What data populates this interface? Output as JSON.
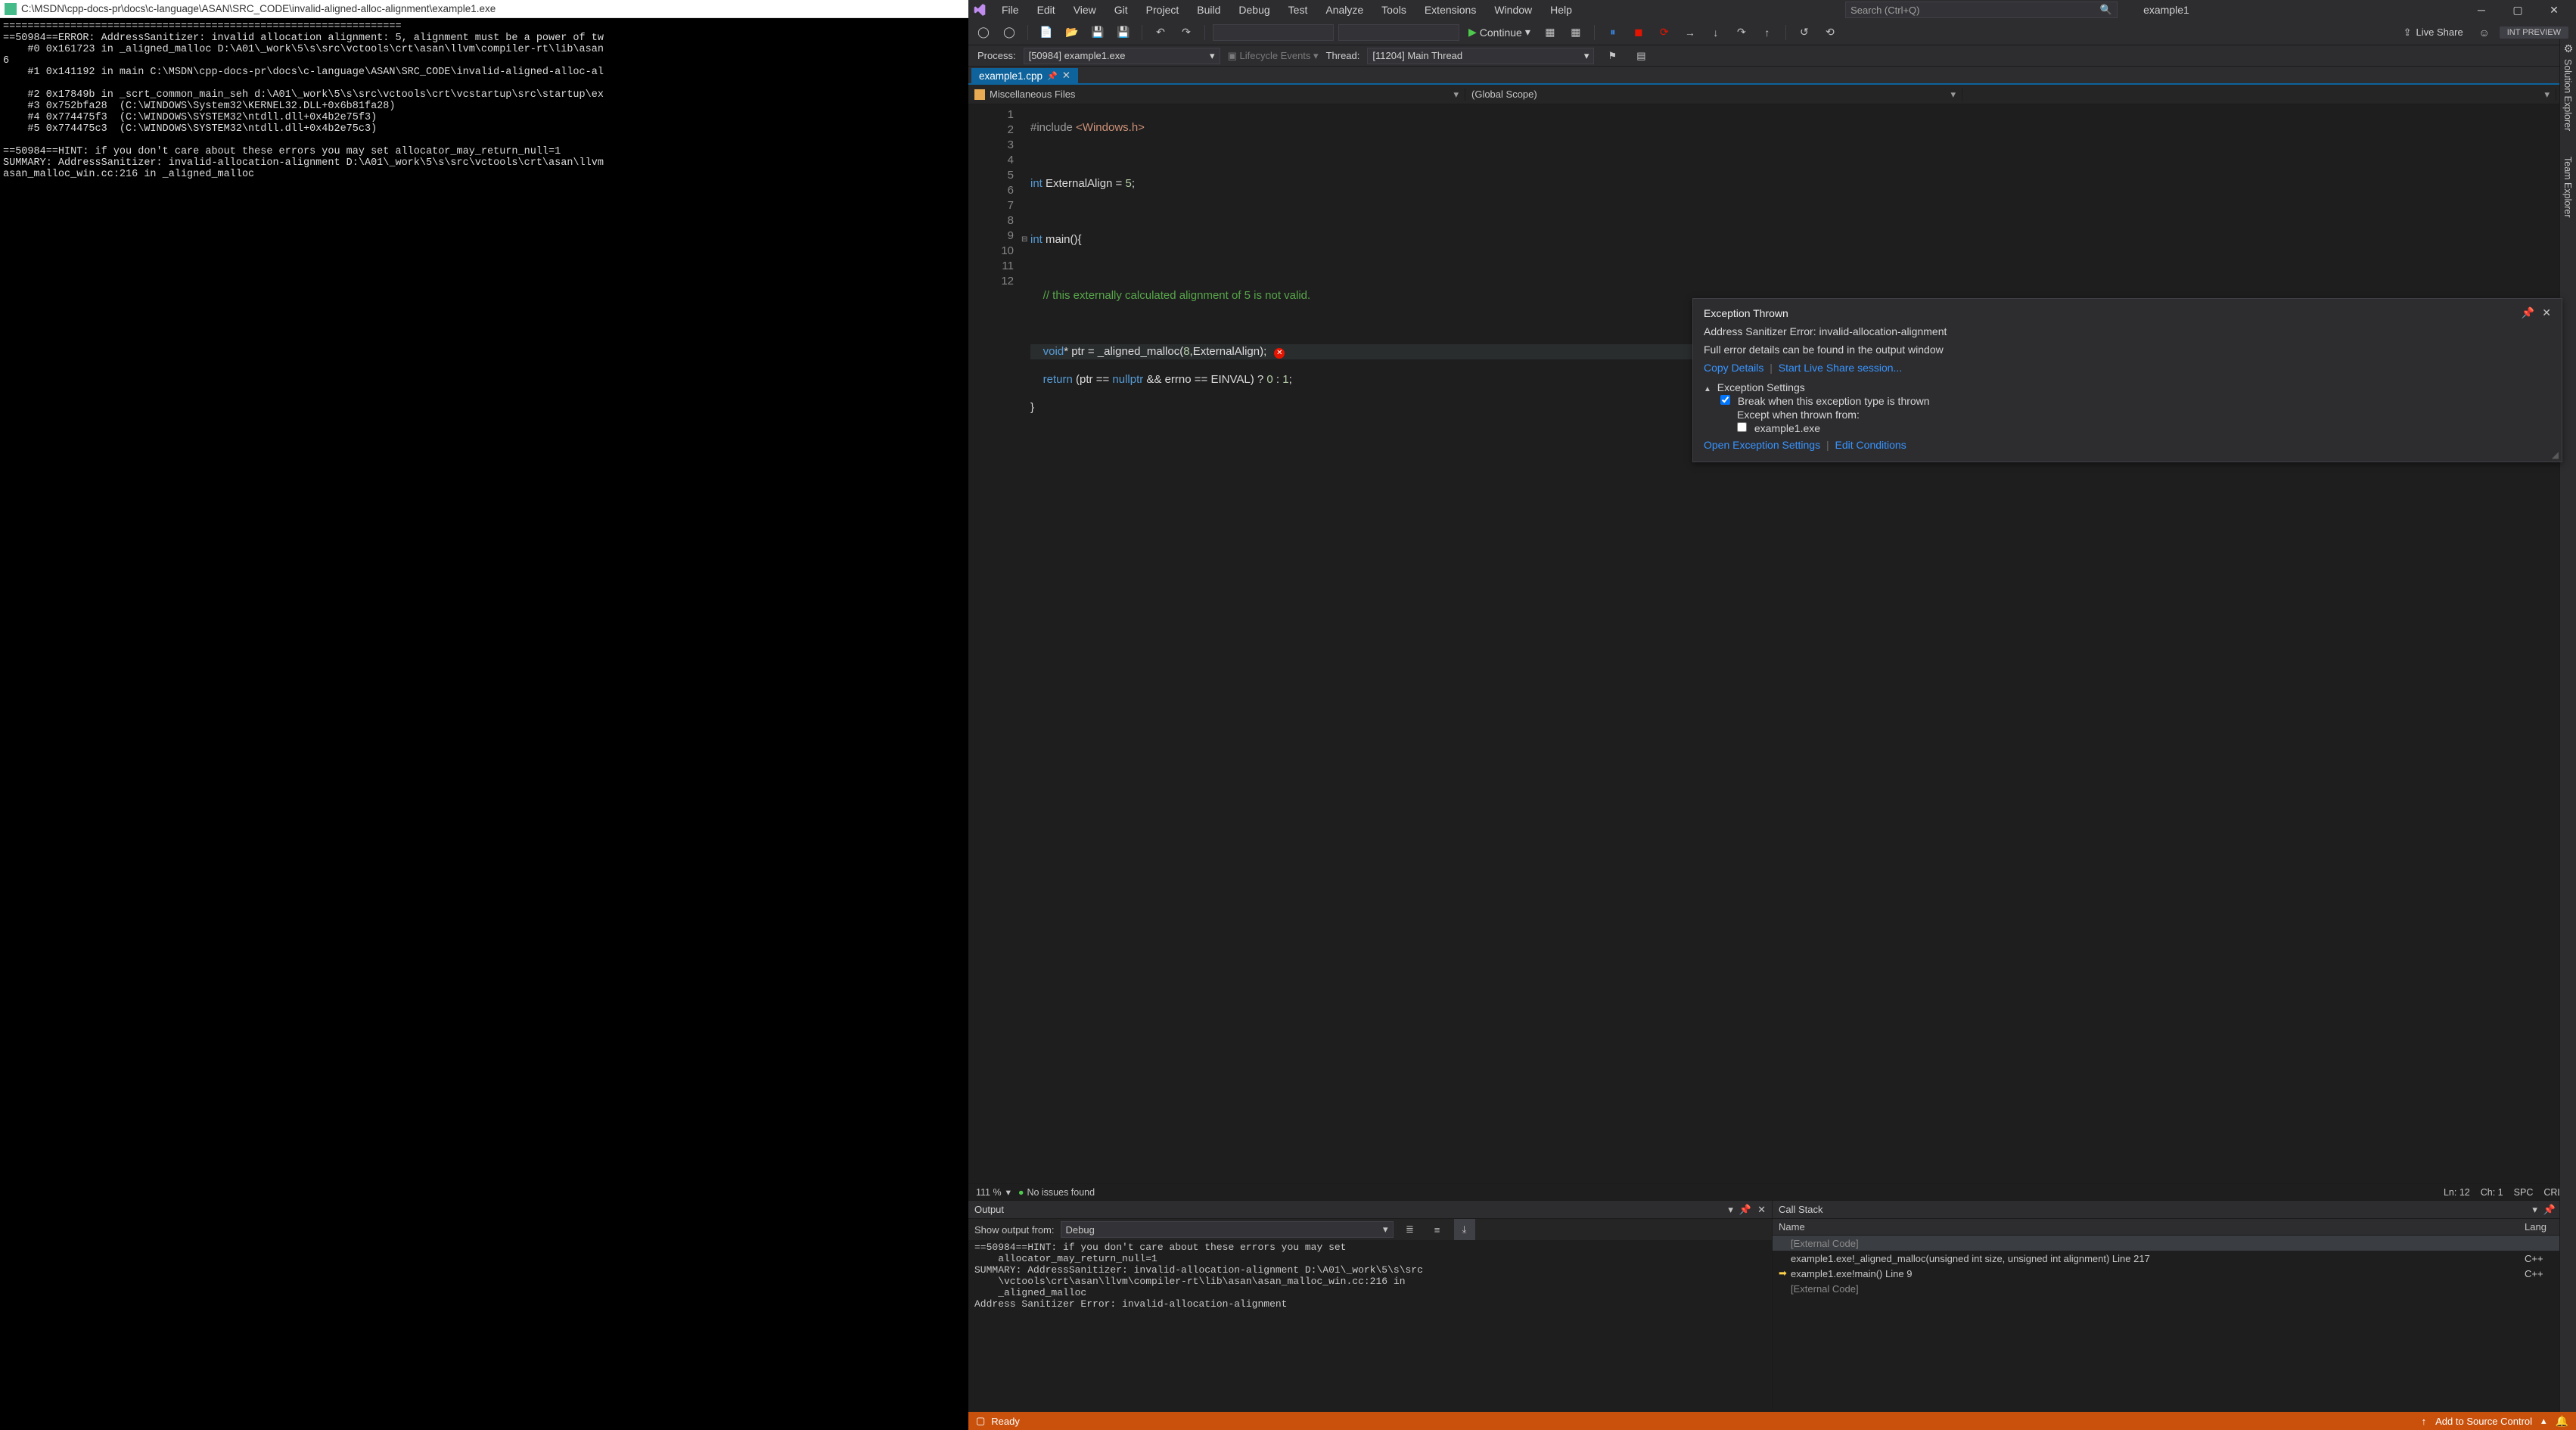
{
  "console": {
    "title_path": "C:\\MSDN\\cpp-docs-pr\\docs\\c-language\\ASAN\\SRC_CODE\\invalid-aligned-alloc-alignment\\example1.exe",
    "body": "=================================================================\n==50984==ERROR: AddressSanitizer: invalid allocation alignment: 5, alignment must be a power of tw\n    #0 0x161723 in _aligned_malloc D:\\A01\\_work\\5\\s\\src\\vctools\\crt\\asan\\llvm\\compiler-rt\\lib\\asan\n6\n    #1 0x141192 in main C:\\MSDN\\cpp-docs-pr\\docs\\c-language\\ASAN\\SRC_CODE\\invalid-aligned-alloc-al\n\n    #2 0x17849b in _scrt_common_main_seh d:\\A01\\_work\\5\\s\\src\\vctools\\crt\\vcstartup\\src\\startup\\ex\n    #3 0x752bfa28  (C:\\WINDOWS\\System32\\KERNEL32.DLL+0x6b81fa28)\n    #4 0x774475f3  (C:\\WINDOWS\\SYSTEM32\\ntdll.dll+0x4b2e75f3)\n    #5 0x774475c3  (C:\\WINDOWS\\SYSTEM32\\ntdll.dll+0x4b2e75c3)\n\n==50984==HINT: if you don't care about these errors you may set allocator_may_return_null=1\nSUMMARY: AddressSanitizer: invalid-allocation-alignment D:\\A01\\_work\\5\\s\\src\\vctools\\crt\\asan\\llvm\nasan_malloc_win.cc:216 in _aligned_malloc"
  },
  "vs": {
    "title": "example1",
    "menu": [
      "File",
      "Edit",
      "View",
      "Git",
      "Project",
      "Build",
      "Debug",
      "Test",
      "Analyze",
      "Tools",
      "Extensions",
      "Window",
      "Help"
    ],
    "search_placeholder": "Search (Ctrl+Q)",
    "preview_badge": "INT PREVIEW",
    "toolbar": {
      "continue_label": "Continue",
      "live_share": "Live Share"
    },
    "debugbar": {
      "process_label": "Process:",
      "process_value": "[50984] example1.exe",
      "lifecycle": "Lifecycle Events",
      "thread_label": "Thread:",
      "thread_value": "[11204] Main Thread"
    },
    "tab": {
      "name": "example1.cpp"
    },
    "scope": {
      "left": "Miscellaneous Files",
      "right": "(Global Scope)"
    },
    "code_lines": {
      "l1": "#include <Windows.h>",
      "l3_a": "int",
      "l3_b": " ExternalAlign = ",
      "l3_c": "5",
      "l3_d": ";",
      "l5_a": "int",
      "l5_b": " main(){",
      "l7_a": "    // this externally calculated alignment of 5 is not valid.",
      "l9_a": "    void",
      "l9_b": "* ptr = _aligned_malloc(",
      "l9_c": "8",
      "l9_d": ",ExternalAlign);",
      "l10_a": "    return",
      "l10_b": " (ptr == ",
      "l10_c": "nullptr",
      "l10_d": " && errno == EINVAL) ? ",
      "l10_e": "0",
      "l10_f": " : ",
      "l10_g": "1",
      "l10_h": ";",
      "l11": "}"
    },
    "editor_status": {
      "zoom": "111 %",
      "issues": "No issues found",
      "ln": "Ln: 12",
      "ch": "Ch: 1",
      "spc": "SPC",
      "crlf": "CRLF"
    },
    "exception": {
      "title": "Exception Thrown",
      "message": "Address Sanitizer Error: invalid-allocation-alignment",
      "detail": "Full error details can be found in the output window",
      "copy": "Copy Details",
      "liveshare": "Start Live Share session...",
      "settings_hdr": "Exception Settings",
      "break_label": "Break when this exception type is thrown",
      "except_label": "Except when thrown from:",
      "except_item": "example1.exe",
      "open_settings": "Open Exception Settings",
      "edit_cond": "Edit Conditions"
    },
    "output": {
      "title": "Output",
      "from_label": "Show output from:",
      "from_value": "Debug",
      "body": "==50984==HINT: if you don't care about these errors you may set\n    allocator_may_return_null=1\nSUMMARY: AddressSanitizer: invalid-allocation-alignment D:\\A01\\_work\\5\\s\\src\n    \\vctools\\crt\\asan\\llvm\\compiler-rt\\lib\\asan\\asan_malloc_win.cc:216 in\n    _aligned_malloc\nAddress Sanitizer Error: invalid-allocation-alignment"
    },
    "callstack": {
      "title": "Call Stack",
      "col_name": "Name",
      "col_lang": "Lang",
      "rows": [
        {
          "name": "[External Code]",
          "lang": "",
          "dim": true
        },
        {
          "name": "example1.exe!_aligned_malloc(unsigned int size, unsigned int alignment) Line 217",
          "lang": "C++"
        },
        {
          "name": "example1.exe!main() Line 9",
          "lang": "C++",
          "current": true
        },
        {
          "name": "[External Code]",
          "lang": "",
          "dim": true
        }
      ]
    },
    "statusbar": {
      "ready": "Ready",
      "add_src": "Add to Source Control"
    },
    "rail": {
      "solution": "Solution Explorer",
      "team": "Team Explorer"
    }
  }
}
